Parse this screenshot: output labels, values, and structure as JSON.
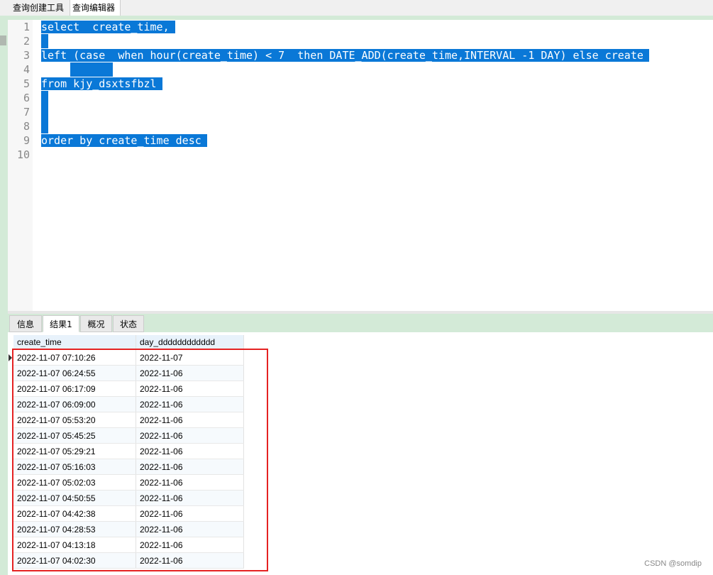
{
  "tabs": {
    "query_builder": "查询创建工具",
    "query_editor": "查询编辑器"
  },
  "editor": {
    "line_numbers": [
      "1",
      "2",
      "3",
      "4",
      "5",
      "6",
      "7",
      "8",
      "9",
      "10"
    ],
    "lines": [
      "select  create_time,",
      "",
      "left (case  when hour(create_time) < 7  then DATE_ADD(create_time,INTERVAL -1 DAY) else create",
      "",
      "from kjy_dsxtsfbzl",
      "",
      "",
      "",
      "order by create_time desc",
      ""
    ]
  },
  "result_tabs": {
    "info": "信息",
    "result1": "结果1",
    "overview": "概况",
    "status": "状态"
  },
  "grid": {
    "columns": [
      "create_time",
      "day_dddddddddddd"
    ],
    "rows": [
      [
        "2022-11-07 07:10:26",
        "2022-11-07"
      ],
      [
        "2022-11-07 06:24:55",
        "2022-11-06"
      ],
      [
        "2022-11-07 06:17:09",
        "2022-11-06"
      ],
      [
        "2022-11-07 06:09:00",
        "2022-11-06"
      ],
      [
        "2022-11-07 05:53:20",
        "2022-11-06"
      ],
      [
        "2022-11-07 05:45:25",
        "2022-11-06"
      ],
      [
        "2022-11-07 05:29:21",
        "2022-11-06"
      ],
      [
        "2022-11-07 05:16:03",
        "2022-11-06"
      ],
      [
        "2022-11-07 05:02:03",
        "2022-11-06"
      ],
      [
        "2022-11-07 04:50:55",
        "2022-11-06"
      ],
      [
        "2022-11-07 04:42:38",
        "2022-11-06"
      ],
      [
        "2022-11-07 04:28:53",
        "2022-11-06"
      ],
      [
        "2022-11-07 04:13:18",
        "2022-11-06"
      ],
      [
        "2022-11-07 04:02:30",
        "2022-11-06"
      ]
    ]
  },
  "watermark": "CSDN @somdip",
  "colors": {
    "selection": "#0a78d7",
    "highlight_box": "#e52222",
    "panel_green": "#d3ead7"
  }
}
